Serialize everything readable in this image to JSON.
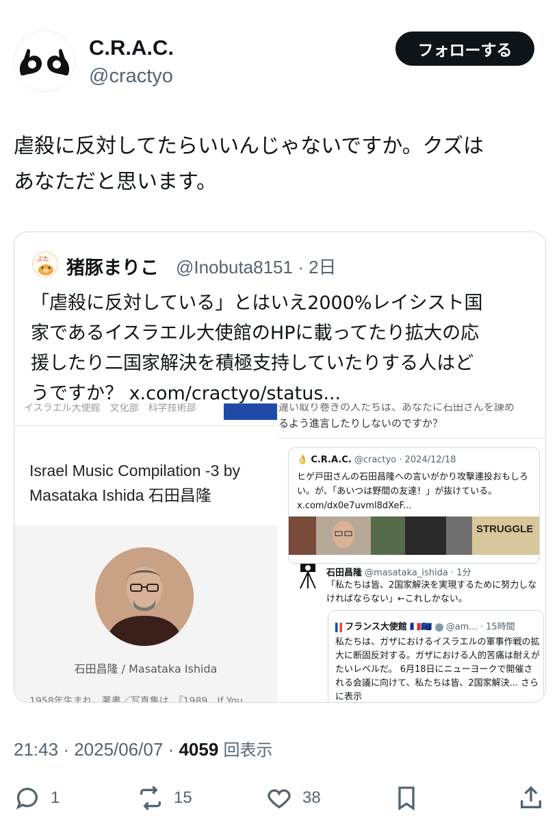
{
  "author": {
    "display_name": "C.R.A.C.",
    "handle": "@cractyo",
    "follow_label": "フォローする"
  },
  "tweet": {
    "line1": "虐殺に反対してたらいいんじゃないですか。クズは",
    "line2": "あなただと思います。"
  },
  "quote": {
    "display_name": "猪豚まりこ",
    "handle_time": "@Inobuta8151 · 2日",
    "line1": "「虐殺に反対している」とはいえ2000%レイシスト国",
    "line2": "家であるイスラエル大使館のHPに載ってたり拡大の応",
    "line3": "援したり二国家解決を積極支持していたりする人はど",
    "line4": "うですか？ x.com/cractyo/status...",
    "image": {
      "left": {
        "top_cut_text": "イスラエル大使館　文化部　科学技術部",
        "title": "Israel Music Compilation -3 by Masataka Ishida 石田昌隆",
        "caption": "石田昌隆 / Masataka Ishida",
        "bio_cut": "1958年生まれ。著書／写真集は、『1989　If You"
      },
      "right": {
        "top_cut_text": "違い取り巻きの人たちは、あなたに石田さんを諫め",
        "top_line": "るよう進言したりしないのですか？",
        "inner_card": {
          "name": "C.R.A.C.",
          "meta": "@cractyo · 2024/12/18",
          "text": "ヒゲ戸田さんの石田昌隆への言いがかり攻撃連投おもしろい。が、「あいつは野間の友達！」が抜けている。 x.com/dx0e7uvml8dXeF..."
        },
        "reply": {
          "name": "石田昌隆",
          "meta": "@masataka_ishida · 1分",
          "text": "「私たちは皆、2国家解決を実現するために努力しなければならない」←これしかない。"
        },
        "embassy_card": {
          "name": "フランス大使館",
          "flags": "🇫🇷🇪🇺",
          "meta": "@am... · 15時間",
          "text": "私たちは、ガザにおけるイスラエルの軍事作戦の拡大に断固反対する。ガザにおける人的苦痛は耐えがたいレベルだ。 6月18日にニューヨークで開催される会議に向けて、私たちは皆、2国家解決... さらに表示"
        },
        "struggle_label": "STRUGGLE"
      }
    }
  },
  "meta": {
    "time": "21:43",
    "date": "2025/06/07",
    "views": "4059",
    "views_label": "回表示"
  },
  "actions": {
    "replies": "1",
    "reposts": "15",
    "likes": "38"
  },
  "colors": {
    "text": "#0f1419",
    "secondary": "#536471",
    "border": "#cfd9de",
    "follow_bg": "#0f1419"
  }
}
